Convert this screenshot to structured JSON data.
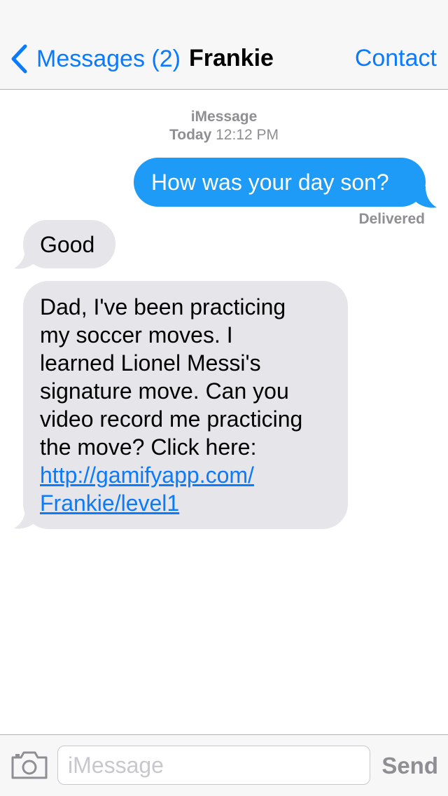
{
  "nav": {
    "back_label": "Messages (2)",
    "title": "Frankie",
    "contact_label": "Contact"
  },
  "thread_header": {
    "service": "iMessage",
    "day": "Today",
    "time": "12:12 PM"
  },
  "messages": [
    {
      "direction": "outgoing",
      "text": "How was your day son?",
      "status": "Delivered"
    },
    {
      "direction": "incoming",
      "text": "Good"
    },
    {
      "direction": "incoming",
      "lines": [
        "Dad, I've been practicing",
        "my soccer moves. I",
        "learned Lionel Messi's",
        "signature move. Can you",
        "video record me practicing",
        "the move? Click here:"
      ],
      "link_lines": [
        "http://gamifyapp.com/",
        "Frankie/level1"
      ]
    }
  ],
  "input_bar": {
    "placeholder": "iMessage",
    "value": "",
    "send_label": "Send",
    "camera_icon": "camera-icon"
  },
  "colors": {
    "accent": "#0a7aff",
    "outgoing_bubble": "#1d9bf6",
    "incoming_bubble": "#e5e5ea",
    "secondary_text": "#8e8e93"
  }
}
